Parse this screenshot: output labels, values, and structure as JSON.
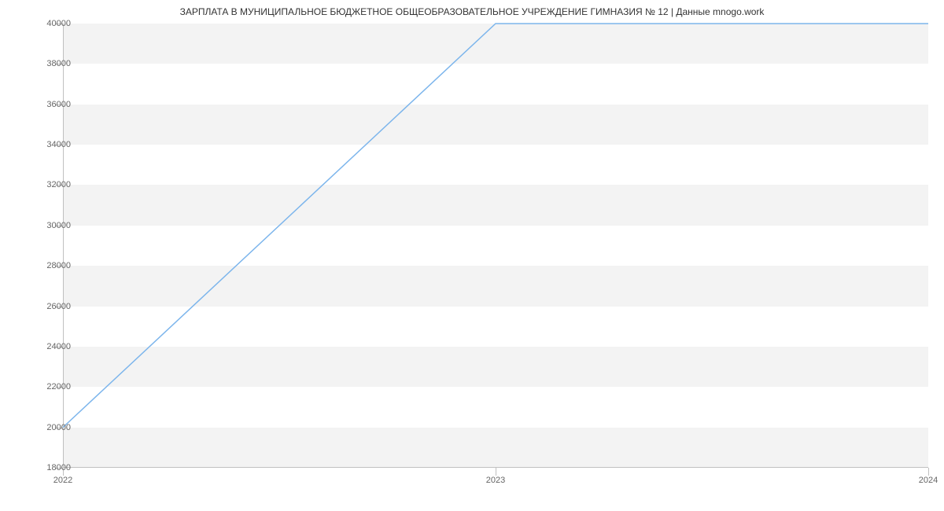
{
  "chart_data": {
    "type": "line",
    "title": "ЗАРПЛАТА В МУНИЦИПАЛЬНОЕ БЮДЖЕТНОЕ ОБЩЕОБРАЗОВАТЕЛЬНОЕ УЧРЕЖДЕНИЕ ГИМНАЗИЯ № 12 | Данные mnogo.work",
    "x": [
      2022,
      2023,
      2024
    ],
    "values": [
      20000,
      40000,
      40000
    ],
    "x_ticks": [
      "2022",
      "2023",
      "2024"
    ],
    "y_ticks": [
      "18000",
      "20000",
      "22000",
      "24000",
      "26000",
      "28000",
      "30000",
      "32000",
      "34000",
      "36000",
      "38000",
      "40000"
    ],
    "xlim": [
      2022,
      2024
    ],
    "ylim": [
      18000,
      40000
    ],
    "line_color": "#7cb5ec",
    "band_color": "#f3f3f3"
  }
}
